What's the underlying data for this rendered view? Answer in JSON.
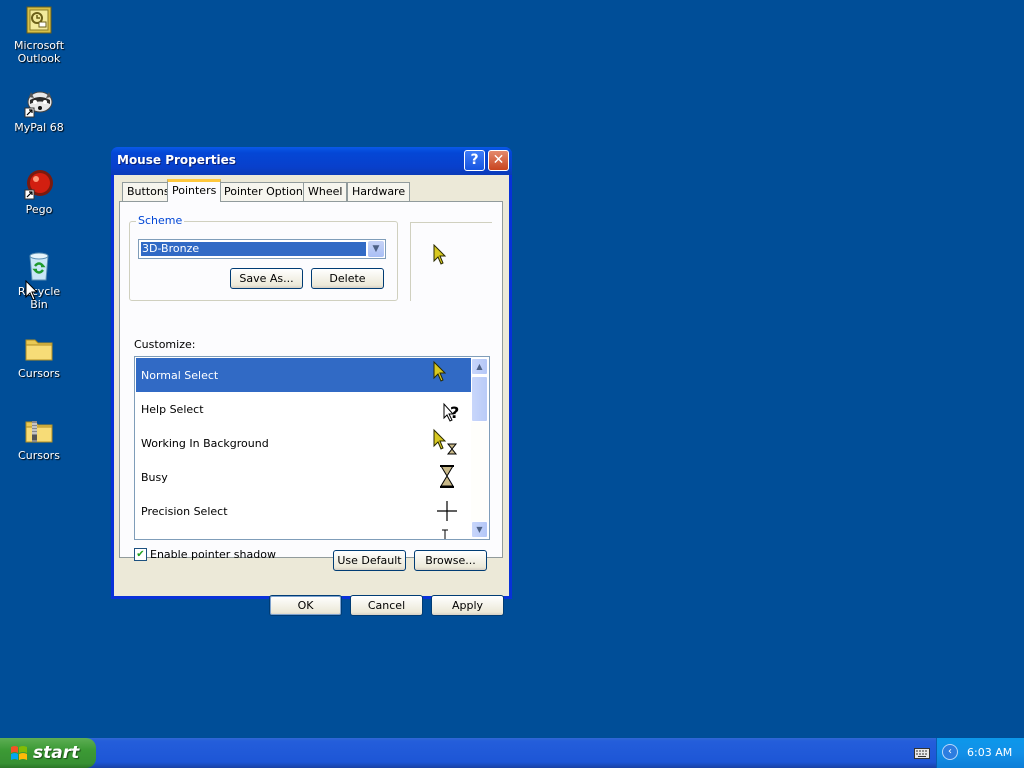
{
  "desktop": {
    "icons": [
      {
        "label": "Microsoft Outlook",
        "icon": "outlook-icon"
      },
      {
        "label": "MyPal 68",
        "icon": "mypal-raccoon-icon"
      },
      {
        "label": "Pego",
        "icon": "pego-red-ball-icon"
      },
      {
        "label": "Recycle Bin",
        "icon": "recycle-bin-icon"
      },
      {
        "label": "Cursors",
        "icon": "folder-icon"
      },
      {
        "label": "Cursors",
        "icon": "zip-folder-icon"
      }
    ]
  },
  "window": {
    "title": "Mouse Properties",
    "help_button": "?",
    "close_button": "✕",
    "tabs": [
      {
        "label": "Buttons",
        "active": false
      },
      {
        "label": "Pointers",
        "active": true
      },
      {
        "label": "Pointer Options",
        "active": false
      },
      {
        "label": "Wheel",
        "active": false
      },
      {
        "label": "Hardware",
        "active": false
      }
    ],
    "scheme": {
      "legend": "Scheme",
      "selected": "3D-Bronze",
      "save_as_label": "Save As...",
      "delete_label": "Delete"
    },
    "customize": {
      "label": "Customize:",
      "items": [
        {
          "label": "Normal Select",
          "cursor": "bronze-arrow-cursor-icon",
          "selected": true
        },
        {
          "label": "Help Select",
          "cursor": "help-select-cursor-icon",
          "selected": false
        },
        {
          "label": "Working In Background",
          "cursor": "working-background-cursor-icon",
          "selected": false
        },
        {
          "label": "Busy",
          "cursor": "hourglass-cursor-icon",
          "selected": false
        },
        {
          "label": "Precision Select",
          "cursor": "crosshair-cursor-icon",
          "selected": false
        }
      ]
    },
    "enable_shadow": {
      "label": "Enable pointer shadow",
      "checked": true
    },
    "use_default_label": "Use Default",
    "browse_label": "Browse...",
    "ok_label": "OK",
    "cancel_label": "Cancel",
    "apply_label": "Apply"
  },
  "taskbar": {
    "start_label": "start",
    "clock": "6:03 AM"
  },
  "colors": {
    "desktop": "#004e98",
    "selection": "#316ac5",
    "titlebar": "#0a5ae9",
    "start_button": "#3c9a35"
  }
}
